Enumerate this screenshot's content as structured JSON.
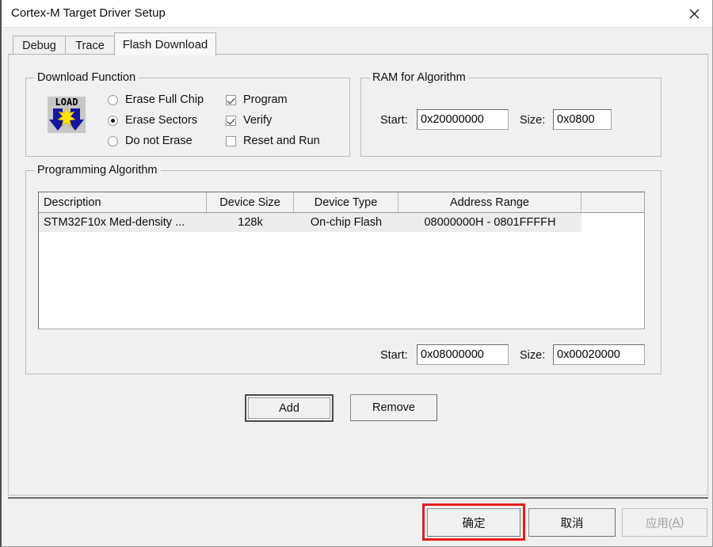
{
  "window": {
    "title": "Cortex-M Target Driver Setup",
    "close_icon": "close-icon"
  },
  "tabs": [
    {
      "label": "Debug",
      "active": false
    },
    {
      "label": "Trace",
      "active": false
    },
    {
      "label": "Flash Download",
      "active": true
    }
  ],
  "download_function": {
    "group_title": "Download Function",
    "icon_text": "LOAD",
    "erase_options": [
      {
        "label": "Erase Full Chip",
        "selected": false
      },
      {
        "label": "Erase Sectors",
        "selected": true
      },
      {
        "label": "Do not Erase",
        "selected": false
      }
    ],
    "checkboxes": [
      {
        "label": "Program",
        "checked": true
      },
      {
        "label": "Verify",
        "checked": true
      },
      {
        "label": "Reset and Run",
        "checked": false
      }
    ]
  },
  "ram_for_algorithm": {
    "group_title": "RAM for Algorithm",
    "start_label": "Start:",
    "start_value": "0x20000000",
    "size_label": "Size:",
    "size_value": "0x0800"
  },
  "programming_algorithm": {
    "group_title": "Programming Algorithm",
    "columns": [
      "Description",
      "Device Size",
      "Device Type",
      "Address Range",
      ""
    ],
    "rows": [
      {
        "description": "STM32F10x Med-density ...",
        "device_size": "128k",
        "device_type": "On-chip Flash",
        "address_range": "08000000H - 0801FFFFH",
        "extra": "",
        "selected": true
      }
    ],
    "start_label": "Start:",
    "start_value": "0x08000000",
    "size_label": "Size:",
    "size_value": "0x00020000",
    "add_button": "Add",
    "remove_button": "Remove"
  },
  "footer": {
    "ok_button": "确定",
    "cancel_button": "取消",
    "apply_button_prefix": "应用(",
    "apply_button_key": "A",
    "apply_button_suffix": ")",
    "apply_disabled": true,
    "highlight_color": "#e81a1a"
  }
}
